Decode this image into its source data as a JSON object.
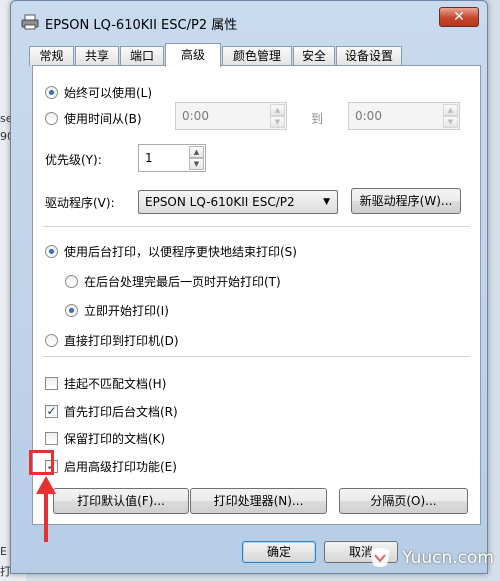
{
  "window": {
    "title": "EPSON LQ-610KII ESC/P2 属性",
    "close_glyph": "✕"
  },
  "tabs": [
    "常规",
    "共享",
    "端口",
    "高级",
    "颜色管理",
    "安全",
    "设备设置"
  ],
  "active_tab": "高级",
  "availability": {
    "always_label": "始终可以使用(L)",
    "time_label": "使用时间从(B)",
    "from_value": "0:00",
    "to_label": "到",
    "to_value": "0:00"
  },
  "priority": {
    "label": "优先级(Y):",
    "value": "1"
  },
  "driver": {
    "label": "驱动程序(V):",
    "selected": "EPSON LQ-610KII ESC/P2",
    "new_driver_button": "新驱动程序(W)..."
  },
  "spool": {
    "spool_label": "使用后台打印，以便程序更快地结束打印(S)",
    "after_last_page_label": "在后台处理完最后一页时开始打印(T)",
    "immediately_label": "立即开始打印(I)",
    "direct_label": "直接打印到打印机(D)"
  },
  "options": [
    {
      "label": "挂起不匹配文档(H)",
      "checked": false
    },
    {
      "label": "首先打印后台文档(R)",
      "checked": true
    },
    {
      "label": "保留打印的文档(K)",
      "checked": false
    },
    {
      "label": "启用高级打印功能(E)",
      "checked": true
    }
  ],
  "bottom_buttons": {
    "defaults": "打印默认值(F)...",
    "processor": "打印处理器(N)...",
    "separator": "分隔页(O)..."
  },
  "footer": {
    "ok": "确定",
    "cancel": "取消"
  },
  "background_text": [
    "se",
    "90",
    "E",
    "打"
  ],
  "watermark": "Yuucn.com",
  "colors": {
    "annotation": "#e83030",
    "title_bar": "#c9daee"
  }
}
